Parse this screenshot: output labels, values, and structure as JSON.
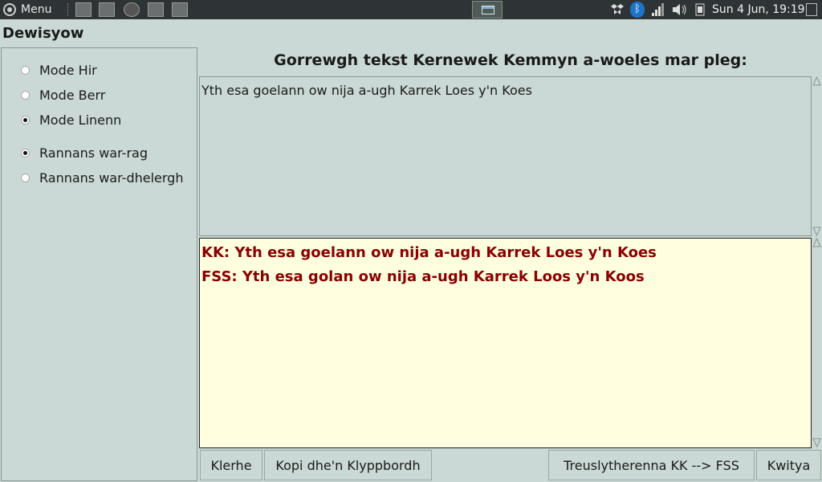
{
  "taskbar": {
    "menu_label": "Menu",
    "clock": "Sun  4 Jun, 19:19"
  },
  "options": {
    "title": "Dewisyow",
    "modes": [
      {
        "label": "Mode Hir",
        "selected": false
      },
      {
        "label": "Mode Berr",
        "selected": false
      },
      {
        "label": "Mode Linenn",
        "selected": true
      }
    ],
    "splits": [
      {
        "label": "Rannans war-rag",
        "selected": true
      },
      {
        "label": "Rannans war-dhelergh",
        "selected": false
      }
    ]
  },
  "main": {
    "prompt": "Gorrewgh tekst Kernewek Kemmyn a-woeles mar pleg:",
    "input_text": "Yth esa goelann ow nija a-ugh Karrek Loes y'n Koes",
    "output_kk": "KK: Yth esa goelann ow nija a-ugh Karrek Loes y'n Koes",
    "output_fss": "FSS: Yth esa golan ow nija a-ugh Karrek Loos y'n Koos"
  },
  "buttons": {
    "clear": "Klerhe",
    "copy": "Kopi dhe'n Klyppbordh",
    "transliterate": "Treuslytherenna KK --> FSS",
    "quit": "Kwitya"
  },
  "colors": {
    "background": "#cad9d5",
    "output_background": "#ffffe0",
    "output_text": "#8b0000"
  }
}
